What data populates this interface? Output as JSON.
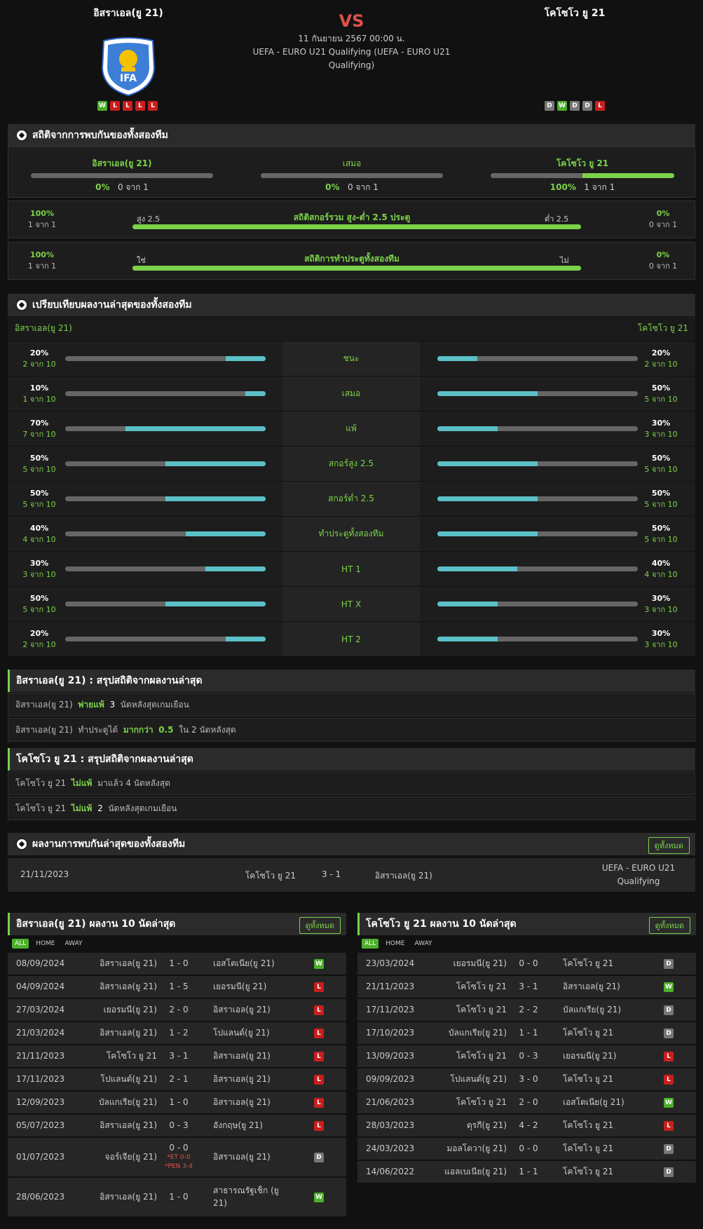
{
  "header": {
    "home_name": "อิสราเอล(ยู 21)",
    "away_name": "โคโซโว ยู 21",
    "vs": "VS",
    "date": "11 กันยายน 2567 00:00 น.",
    "league": "UEFA - EURO U21 Qualifying (UEFA - EURO U21 Qualifying)",
    "home_form": [
      "W",
      "L",
      "L",
      "L",
      "L"
    ],
    "away_form": [
      "D",
      "W",
      "D",
      "D",
      "L"
    ],
    "logo_text": "IFA"
  },
  "h2h": {
    "title": "สถิติจากการพบกันของทั้งสองทีม",
    "home": {
      "label": "อิสราเอล(ยู 21)",
      "pct": "0%",
      "count": "0 จาก 1",
      "value": 0
    },
    "draw": {
      "label": "เสมอ",
      "pct": "0%",
      "count": "0 จาก 1",
      "value": 0
    },
    "away": {
      "label": "โคโซโว ยู 21",
      "pct": "100%",
      "count": "1 จาก 1",
      "value": 1
    },
    "ou": {
      "left_pct": "100%",
      "left_count": "1 จาก 1",
      "over": "สูง 2.5",
      "title": "สถิติสกอร์รวม สูง-ต่ำ 2.5 ประตู",
      "under": "ต่ำ 2.5",
      "right_pct": "0%",
      "right_count": "0 จาก 1",
      "value": 1
    },
    "btts": {
      "left_pct": "100%",
      "left_count": "1 จาก 1",
      "yes": "ใช่",
      "title": "สถิติการทำประตูทั้งสองทีม",
      "no": "ไม่",
      "right_pct": "0%",
      "right_count": "0 จาก 1",
      "value": 1
    }
  },
  "compare": {
    "title": "เปรียบเทียบผลงานล่าสุดของทั้งสองทีม",
    "home": "อิสราเอล(ยู 21)",
    "away": "โคโซโว ยู 21",
    "rows": [
      {
        "label": "ชนะ",
        "hp": "20%",
        "hc": "2 จาก 10",
        "hv": 0.2,
        "ap": "20%",
        "ac": "2 จาก 10",
        "av": 0.2
      },
      {
        "label": "เสมอ",
        "hp": "10%",
        "hc": "1 จาก 10",
        "hv": 0.1,
        "ap": "50%",
        "ac": "5 จาก 10",
        "av": 0.5
      },
      {
        "label": "แพ้",
        "hp": "70%",
        "hc": "7 จาก 10",
        "hv": 0.7,
        "ap": "30%",
        "ac": "3 จาก 10",
        "av": 0.3
      },
      {
        "label": "สกอร์สูง 2.5",
        "hp": "50%",
        "hc": "5 จาก 10",
        "hv": 0.5,
        "ap": "50%",
        "ac": "5 จาก 10",
        "av": 0.5
      },
      {
        "label": "สกอร์ต่ำ 2.5",
        "hp": "50%",
        "hc": "5 จาก 10",
        "hv": 0.5,
        "ap": "50%",
        "ac": "5 จาก 10",
        "av": 0.5
      },
      {
        "label": "ทำประตูทั้งสองทีม",
        "hp": "40%",
        "hc": "4 จาก 10",
        "hv": 0.4,
        "ap": "50%",
        "ac": "5 จาก 10",
        "av": 0.5
      },
      {
        "label": "HT 1",
        "hp": "30%",
        "hc": "3 จาก 10",
        "hv": 0.3,
        "ap": "40%",
        "ac": "4 จาก 10",
        "av": 0.4
      },
      {
        "label": "HT X",
        "hp": "50%",
        "hc": "5 จาก 10",
        "hv": 0.5,
        "ap": "30%",
        "ac": "3 จาก 10",
        "av": 0.3
      },
      {
        "label": "HT 2",
        "hp": "20%",
        "hc": "2 จาก 10",
        "hv": 0.2,
        "ap": "30%",
        "ac": "3 จาก 10",
        "av": 0.3
      }
    ]
  },
  "home_summary": {
    "title": "อิสราเอล(ยู 21) : สรุปสถิติจากผลงานล่าสุด",
    "l1a": "อิสราเอล(ยู 21)",
    "l1b": "พ่ายแพ้",
    "l1c": "3",
    "l1d": "นัดหลังสุดเกมเยือน",
    "l2a": "อิสราเอล(ยู 21)",
    "l2b": "ทำประตูได้",
    "l2c": "มากกว่า",
    "l2d": "0.5",
    "l2e": "ใน 2 นัดหลังสุด"
  },
  "away_summary": {
    "title": "โคโซโว ยู 21 : สรุปสถิติจากผลงานล่าสุด",
    "l1a": "โคโซโว ยู 21",
    "l1b": "ไม่แพ้",
    "l1c": "มาแล้ว 4 นัดหลังสุด",
    "l2a": "โคโซโว ยู 21",
    "l2b": "ไม่แพ้",
    "l2c": "2",
    "l2d": "นัดหลังสุดเกมเยือน"
  },
  "recent_h2h": {
    "title": "ผลงานการพบกันล่าสุดของทั้งสองทีม",
    "view_all": "ดูทั้งหมด",
    "date": "21/11/2023",
    "home": "โคโซโว ยู 21",
    "score": "3 - 1",
    "away": "อิสราเอล(ยู 21)",
    "league": "UEFA - EURO U21 Qualifying"
  },
  "home_last10": {
    "title": "อิสราเอล(ยู 21) ผลงาน 10 นัดล่าสุด",
    "view_all": "ดูทั้งหมด",
    "tabs": [
      "ALL",
      "HOME",
      "AWAY"
    ],
    "matches": [
      {
        "date": "08/09/2024",
        "home": "อิสราเอล(ยู 21)",
        "score": "1 - 0",
        "away": "เอสโตเนีย(ยู 21)",
        "r": "W"
      },
      {
        "date": "04/09/2024",
        "home": "อิสราเอล(ยู 21)",
        "score": "1 - 5",
        "away": "เยอรมนี(ยู 21)",
        "r": "L"
      },
      {
        "date": "27/03/2024",
        "home": "เยอรมนี(ยู 21)",
        "score": "2 - 0",
        "away": "อิสราเอล(ยู 21)",
        "r": "L"
      },
      {
        "date": "21/03/2024",
        "home": "อิสราเอล(ยู 21)",
        "score": "1 - 2",
        "away": "โปแลนด์(ยู 21)",
        "r": "L"
      },
      {
        "date": "21/11/2023",
        "home": "โคโซโว ยู 21",
        "score": "3 - 1",
        "away": "อิสราเอล(ยู 21)",
        "r": "L"
      },
      {
        "date": "17/11/2023",
        "home": "โปแลนด์(ยู 21)",
        "score": "2 - 1",
        "away": "อิสราเอล(ยู 21)",
        "r": "L"
      },
      {
        "date": "12/09/2023",
        "home": "บัลแกเรีย(ยู 21)",
        "score": "1 - 0",
        "away": "อิสราเอล(ยู 21)",
        "r": "L"
      },
      {
        "date": "05/07/2023",
        "home": "อิสราเอล(ยู 21)",
        "score": "0 - 3",
        "away": "อังกฤษ(ยู 21)",
        "r": "L"
      },
      {
        "date": "01/07/2023",
        "home": "จอร์เจีย(ยู 21)",
        "score": "0 - 0",
        "note": "*ET 0-0 *PEN 3-4",
        "away": "อิสราเอล(ยู 21)",
        "r": "D"
      },
      {
        "date": "28/06/2023",
        "home": "อิสราเอล(ยู 21)",
        "score": "1 - 0",
        "away": "สาธารณรัฐเช็ก (ยู 21)",
        "r": "W"
      }
    ]
  },
  "away_last10": {
    "title": "โคโซโว ยู 21 ผลงาน 10 นัดล่าสุด",
    "view_all": "ดูทั้งหมด",
    "tabs": [
      "ALL",
      "HOME",
      "AWAY"
    ],
    "matches": [
      {
        "date": "23/03/2024",
        "home": "เยอรมนี(ยู 21)",
        "score": "0 - 0",
        "away": "โคโซโว ยู 21",
        "r": "D"
      },
      {
        "date": "21/11/2023",
        "home": "โคโซโว ยู 21",
        "score": "3 - 1",
        "away": "อิสราเอล(ยู 21)",
        "r": "W"
      },
      {
        "date": "17/11/2023",
        "home": "โคโซโว ยู 21",
        "score": "2 - 2",
        "away": "บัลแกเรีย(ยู 21)",
        "r": "D"
      },
      {
        "date": "17/10/2023",
        "home": "บัลแกเรีย(ยู 21)",
        "score": "1 - 1",
        "away": "โคโซโว ยู 21",
        "r": "D"
      },
      {
        "date": "13/09/2023",
        "home": "โคโซโว ยู 21",
        "score": "0 - 3",
        "away": "เยอรมนี(ยู 21)",
        "r": "L"
      },
      {
        "date": "09/09/2023",
        "home": "โปแลนด์(ยู 21)",
        "score": "3 - 0",
        "away": "โคโซโว ยู 21",
        "r": "L"
      },
      {
        "date": "21/06/2023",
        "home": "โคโซโว ยู 21",
        "score": "2 - 0",
        "away": "เอสโตเนีย(ยู 21)",
        "r": "W"
      },
      {
        "date": "28/03/2023",
        "home": "ตุรกี(ยู 21)",
        "score": "4 - 2",
        "away": "โคโซโว ยู 21",
        "r": "L"
      },
      {
        "date": "24/03/2023",
        "home": "มอลโดวา(ยู 21)",
        "score": "0 - 0",
        "away": "โคโซโว ยู 21",
        "r": "D"
      },
      {
        "date": "14/06/2022",
        "home": "แอลเบเนีย(ยู 21)",
        "score": "1 - 1",
        "away": "โคโซโว ยู 21",
        "r": "D"
      }
    ]
  }
}
